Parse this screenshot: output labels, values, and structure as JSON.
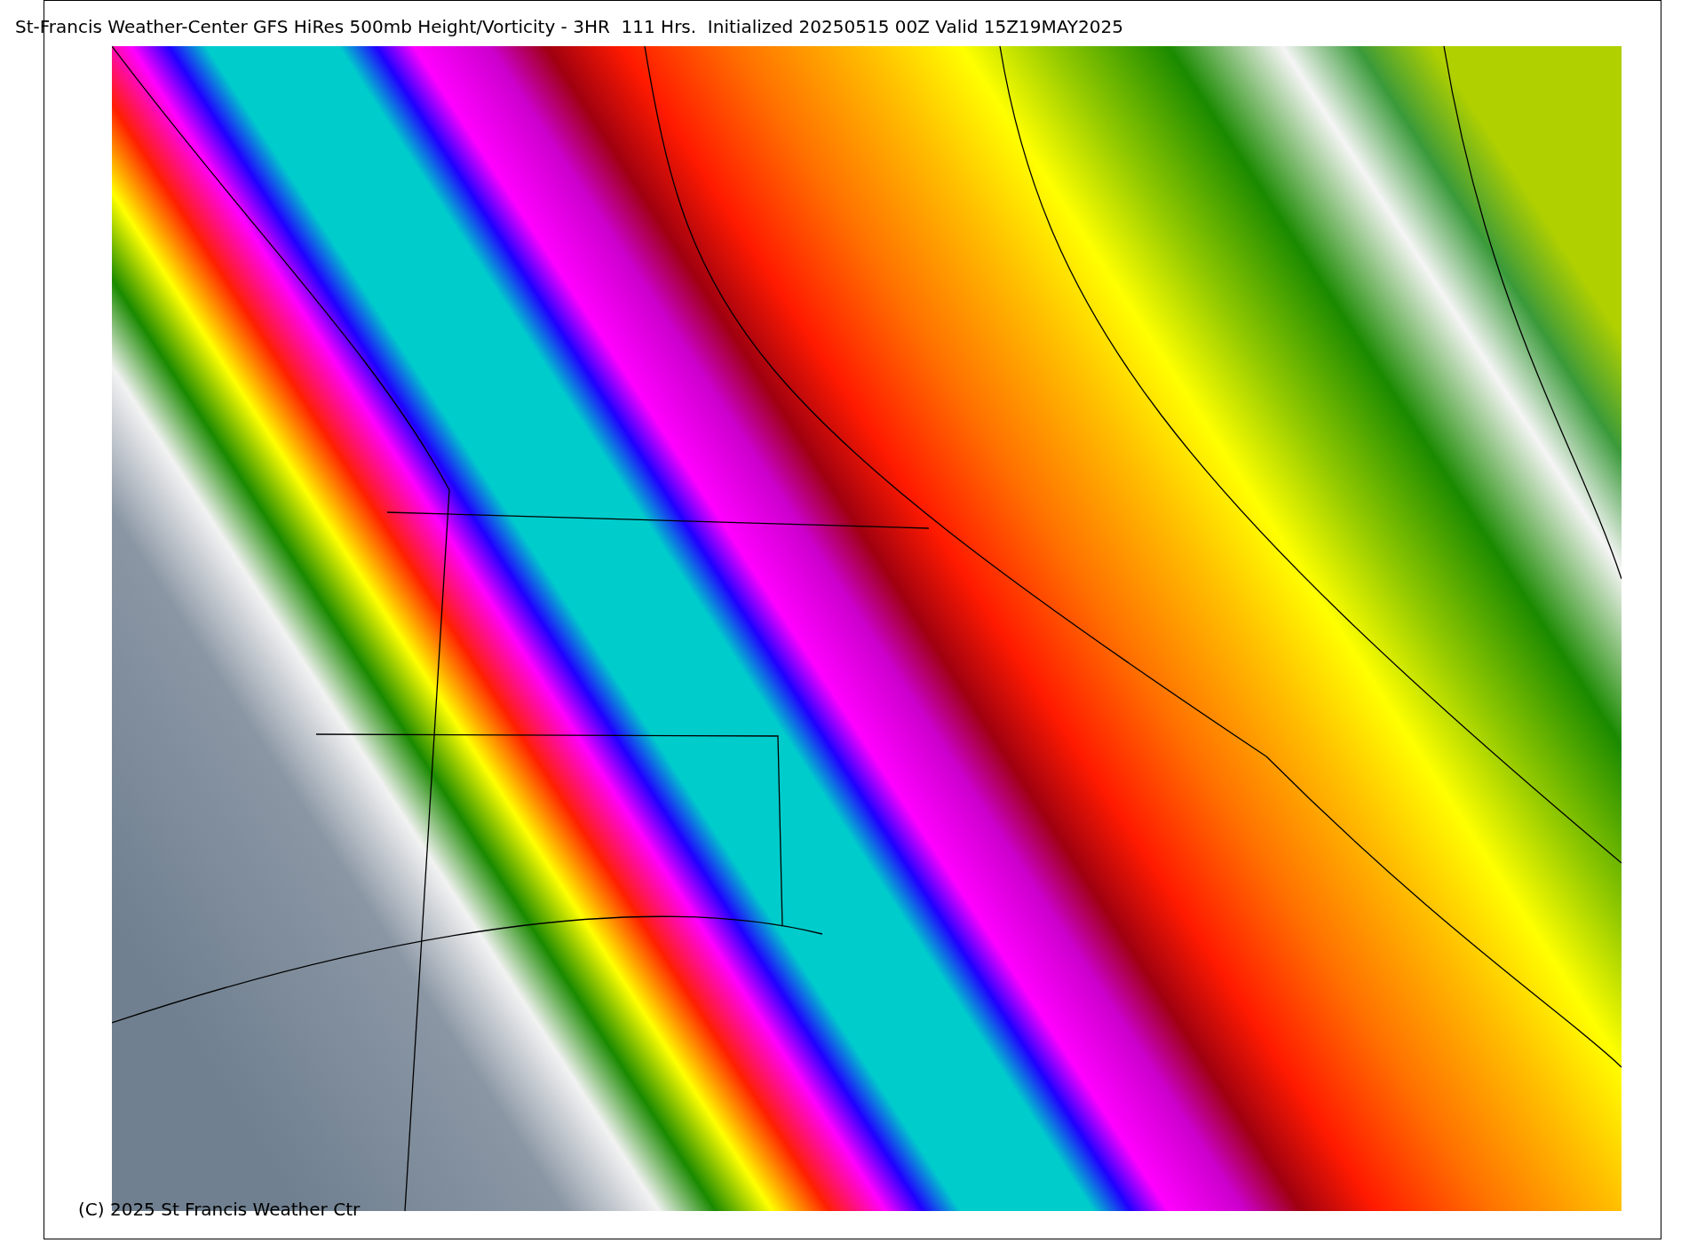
{
  "title": "St-Francis Weather-Center GFS HiRes 500mb Height/Vorticity - 3HR  111 Hrs.  Initialized 20250515 00Z Valid 15Z19MAY2025",
  "copyright": "(C) 2025 St Francis Weather Ctr"
}
